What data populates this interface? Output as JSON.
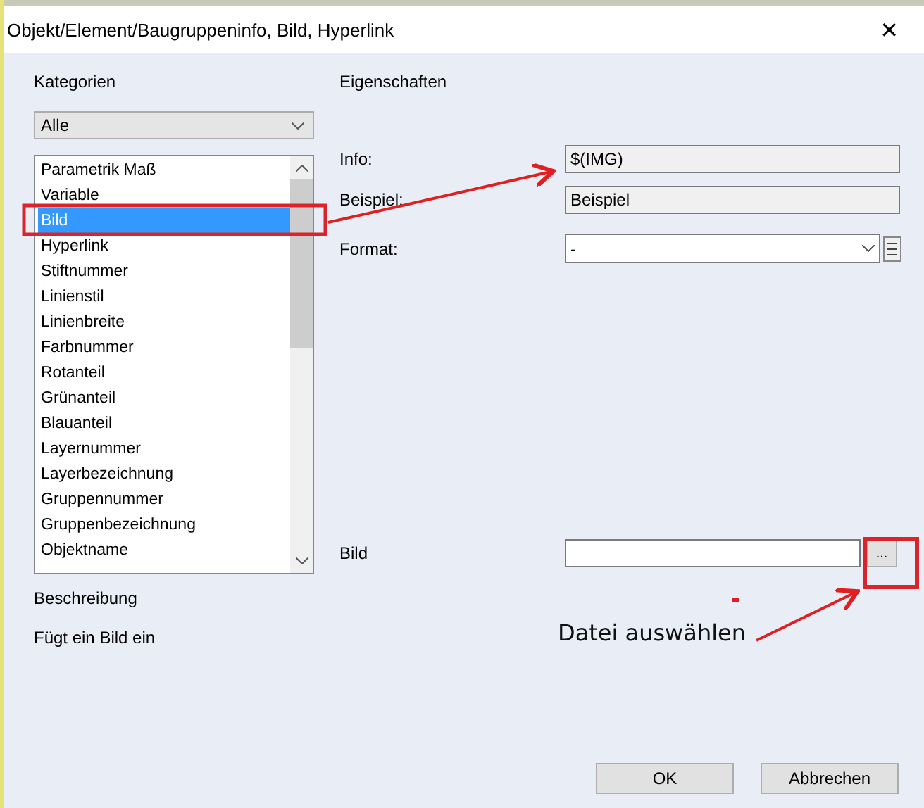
{
  "window": {
    "title": "Objekt/Element/Baugruppeninfo, Bild, Hyperlink",
    "close": "✕"
  },
  "categories": {
    "label": "Kategorien",
    "filter": "Alle",
    "items": [
      {
        "label": "Parametrik Maß",
        "selected": false
      },
      {
        "label": "Variable",
        "selected": false
      },
      {
        "label": "Bild",
        "selected": true
      },
      {
        "label": "Hyperlink",
        "selected": false
      },
      {
        "label": "Stiftnummer",
        "selected": false
      },
      {
        "label": "Linienstil",
        "selected": false
      },
      {
        "label": "Linienbreite",
        "selected": false
      },
      {
        "label": "Farbnummer",
        "selected": false
      },
      {
        "label": "Rotanteil",
        "selected": false
      },
      {
        "label": "Grünanteil",
        "selected": false
      },
      {
        "label": "Blauanteil",
        "selected": false
      },
      {
        "label": "Layernummer",
        "selected": false
      },
      {
        "label": "Layerbezeichnung",
        "selected": false
      },
      {
        "label": "Gruppennummer",
        "selected": false
      },
      {
        "label": "Gruppenbezeichnung",
        "selected": false
      },
      {
        "label": "Objektname",
        "selected": false
      }
    ]
  },
  "properties": {
    "label": "Eigenschaften",
    "info_label": "Info:",
    "info_value": "$(IMG)",
    "example_label": "Beispiel:",
    "example_value": "Beispiel",
    "format_label": "Format:",
    "format_value": "-",
    "image_label": "Bild",
    "browse": "..."
  },
  "description": {
    "label": "Beschreibung",
    "text": "Fügt ein Bild ein"
  },
  "buttons": [
    "OK",
    "Abbrechen"
  ],
  "annotation": {
    "note": "Datei auswählen"
  }
}
